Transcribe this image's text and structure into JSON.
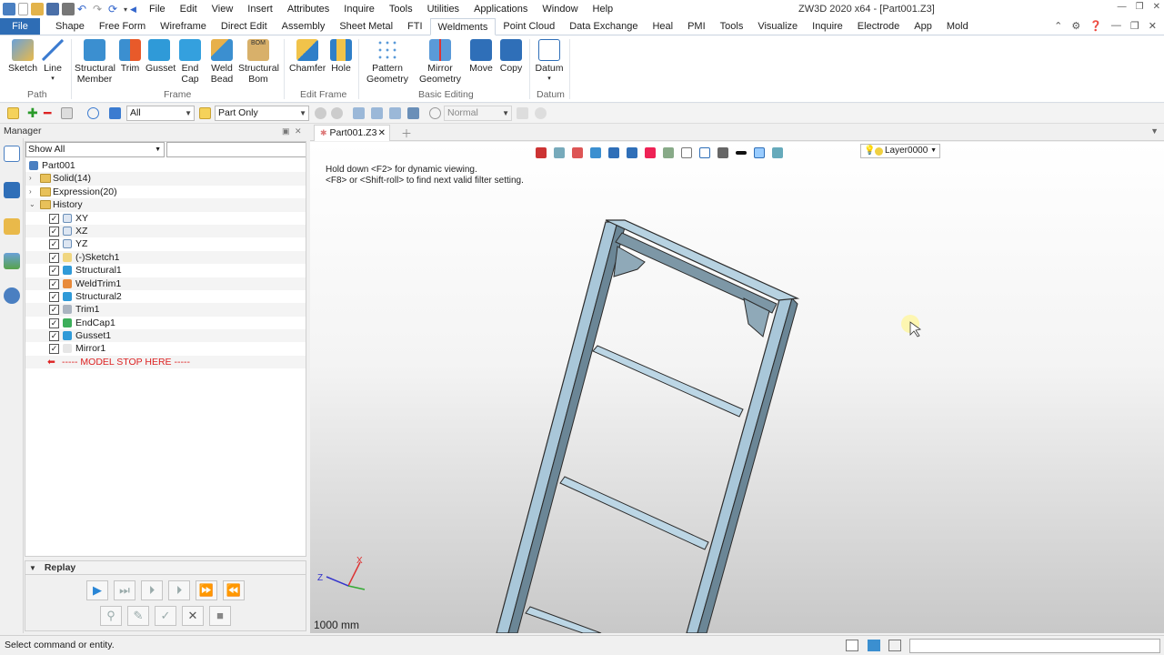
{
  "app": {
    "title": "ZW3D 2020 x64 - [Part001.Z3]"
  },
  "menu": [
    "File",
    "Edit",
    "View",
    "Insert",
    "Attributes",
    "Inquire",
    "Tools",
    "Utilities",
    "Applications",
    "Window",
    "Help"
  ],
  "ribbon_tabs": {
    "file": "File",
    "items": [
      "Shape",
      "Free Form",
      "Wireframe",
      "Direct Edit",
      "Assembly",
      "Sheet Metal",
      "FTI",
      "Weldments",
      "Point Cloud",
      "Data Exchange",
      "Heal",
      "PMI",
      "Tools",
      "Visualize",
      "Inquire",
      "Electrode",
      "App",
      "Mold"
    ],
    "active": "Weldments"
  },
  "ribbon": {
    "sketch": "Sketch",
    "line": "Line",
    "structural_member": [
      "Structural",
      "Member"
    ],
    "trim": "Trim",
    "gusset": "Gusset",
    "end_cap": [
      "End",
      "Cap"
    ],
    "weld_bead": [
      "Weld",
      "Bead"
    ],
    "structural_bom": [
      "Structural",
      "Bom"
    ],
    "chamfer": "Chamfer",
    "hole": "Hole",
    "pattern_geometry": [
      "Pattern",
      "Geometry"
    ],
    "mirror_geometry": [
      "Mirror",
      "Geometry"
    ],
    "move": "Move",
    "copy": "Copy",
    "datum": "Datum",
    "groups": {
      "path": "Path",
      "frame": "Frame",
      "edit_frame": "Edit Frame",
      "basic_editing": "Basic Editing",
      "datum": "Datum"
    }
  },
  "toolbar": {
    "filter_value": "All",
    "scope_value": "Part Only",
    "display_value": "Normal"
  },
  "manager": {
    "title": "Manager",
    "filter": "Show All",
    "tree": [
      {
        "label": "Part001",
        "level": 0,
        "kind": "part"
      },
      {
        "label": "Solid(14)",
        "level": 1,
        "kind": "folder",
        "expand": "›"
      },
      {
        "label": "Expression(20)",
        "level": 1,
        "kind": "folder",
        "expand": "›"
      },
      {
        "label": "History",
        "level": 1,
        "kind": "folder",
        "expand": "⌄"
      },
      {
        "label": "XY",
        "level": 2,
        "kind": "plane",
        "checked": true
      },
      {
        "label": "XZ",
        "level": 2,
        "kind": "plane",
        "checked": true
      },
      {
        "label": "YZ",
        "level": 2,
        "kind": "plane",
        "checked": true
      },
      {
        "label": "(-)Sketch1",
        "level": 2,
        "kind": "sketch",
        "checked": true
      },
      {
        "label": "Structural1",
        "level": 2,
        "kind": "feature",
        "checked": true
      },
      {
        "label": "WeldTrim1",
        "level": 2,
        "kind": "trim",
        "checked": true
      },
      {
        "label": "Structural2",
        "level": 2,
        "kind": "feature",
        "checked": true
      },
      {
        "label": "Trim1",
        "level": 2,
        "kind": "trim2",
        "checked": true
      },
      {
        "label": "EndCap1",
        "level": 2,
        "kind": "feature2",
        "checked": true
      },
      {
        "label": "Gusset1",
        "level": 2,
        "kind": "feature",
        "checked": true
      },
      {
        "label": "Mirror1",
        "level": 2,
        "kind": "mirror",
        "checked": true
      },
      {
        "label": "----- MODEL STOP HERE -----",
        "level": 1,
        "kind": "stop"
      }
    ]
  },
  "replay": {
    "title": "Replay"
  },
  "document": {
    "tab": "Part001.Z3"
  },
  "viewport": {
    "hint1": "Hold down <F2> for dynamic viewing.",
    "hint2": "<F8> or <Shift-roll> to find next valid filter setting.",
    "layer": "Layer0000",
    "scale": "1000 mm",
    "triad": {
      "x": "X",
      "z": "Z"
    }
  },
  "status": {
    "message": "Select command or entity."
  },
  "colors": {
    "accent": "#2e6db5",
    "frame": "#a9c7d9",
    "stop": "#dd2222"
  }
}
